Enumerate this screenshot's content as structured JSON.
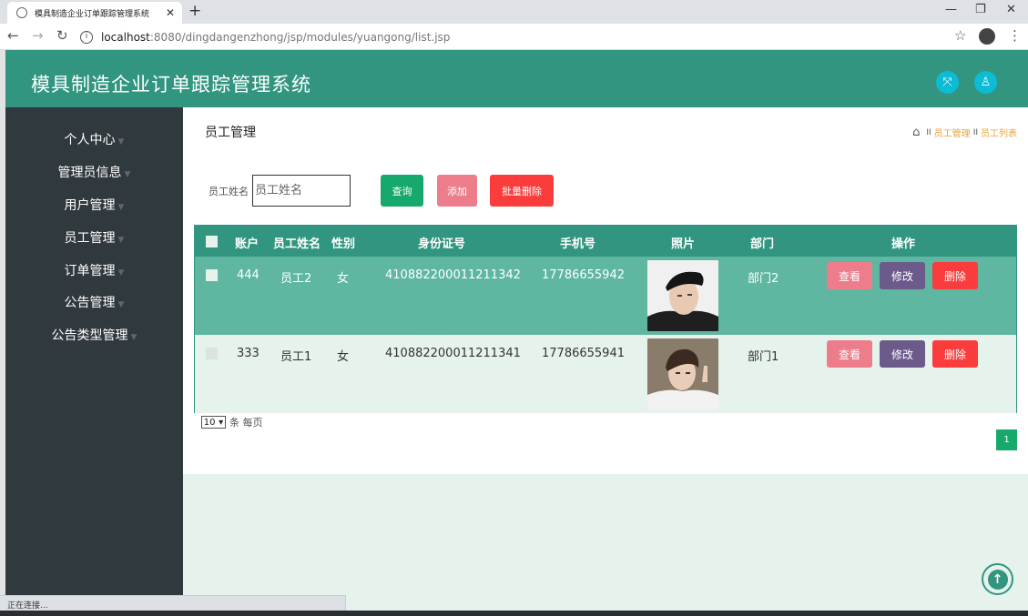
{
  "browser": {
    "tab_title": "模具制造企业订单跟踪管理系统",
    "new_tab": "+",
    "url_host": "localhost",
    "url_path": ":8080/dingdangenzhong/jsp/modules/yuangong/list.jsp",
    "status_text": "正在连接..."
  },
  "header": {
    "title": "模具制造企业订单跟踪管理系统"
  },
  "sidebar": {
    "items": [
      {
        "label": "个人中心"
      },
      {
        "label": "管理员信息"
      },
      {
        "label": "用户管理"
      },
      {
        "label": "员工管理"
      },
      {
        "label": "订单管理"
      },
      {
        "label": "公告管理"
      },
      {
        "label": "公告类型管理"
      }
    ]
  },
  "page": {
    "title": "员工管理",
    "breadcrumb": [
      "员工管理",
      "员工列表"
    ]
  },
  "search": {
    "label": "员工姓名",
    "placeholder": "员工姓名",
    "query_label": "查询",
    "add_label": "添加",
    "batch_delete_label": "批量删除"
  },
  "table": {
    "columns": [
      "账户",
      "员工姓名",
      "性别",
      "身份证号",
      "手机号",
      "照片",
      "部门",
      "操作"
    ],
    "rows": [
      {
        "account": "444",
        "name": "员工2",
        "gender": "女",
        "id_number": "410882200011211342",
        "phone": "17786655942",
        "department": "部门2"
      },
      {
        "account": "333",
        "name": "员工1",
        "gender": "女",
        "id_number": "410882200011211341",
        "phone": "17786655941",
        "department": "部门1"
      }
    ],
    "actions": {
      "view": "查看",
      "edit": "修改",
      "delete": "删除"
    }
  },
  "pager": {
    "page_size": "10",
    "suffix": "条 每页",
    "current_page": "1"
  },
  "colors": {
    "primary": "#319580",
    "sidebar": "#30393d",
    "row_selected": "#5fb6a1",
    "row_normal": "#e6f2ec",
    "btn_query": "#17a86c",
    "btn_add": "#ed7d8b",
    "btn_delete": "#fb3c3c",
    "btn_edit": "#6c5b8a",
    "accent_cyan": "#0bbcd4"
  }
}
